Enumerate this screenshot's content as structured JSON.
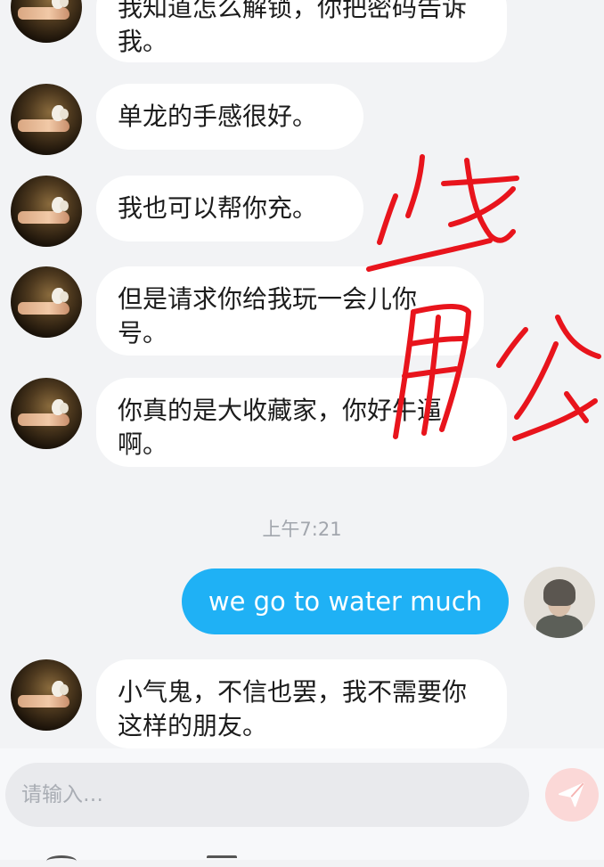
{
  "messages": [
    {
      "text": "我知道怎么解锁，你把密码告诉我。"
    },
    {
      "text": "单龙的手感很好。"
    },
    {
      "text": "我也可以帮你充。"
    },
    {
      "text": "但是请求你给我玩一会儿你号。"
    },
    {
      "text": "你真的是大收藏家，你好牛逼啊。"
    },
    {
      "text": "小气鬼，不信也罢，我不需要你这样的朋友。"
    }
  ],
  "timestamp": "上午7:21",
  "my_message": {
    "text": "we go to water much"
  },
  "input": {
    "placeholder": "请输入…",
    "value": ""
  },
  "icons": {
    "send": "paper-plane-icon"
  },
  "colors": {
    "background": "#f2f3f5",
    "incoming_bubble": "#ffffff",
    "outgoing_bubble": "#1fb1f5",
    "send_button": "#fbd8d7",
    "scribble": "#e8141c"
  },
  "annotation": {
    "text": "收用公"
  }
}
